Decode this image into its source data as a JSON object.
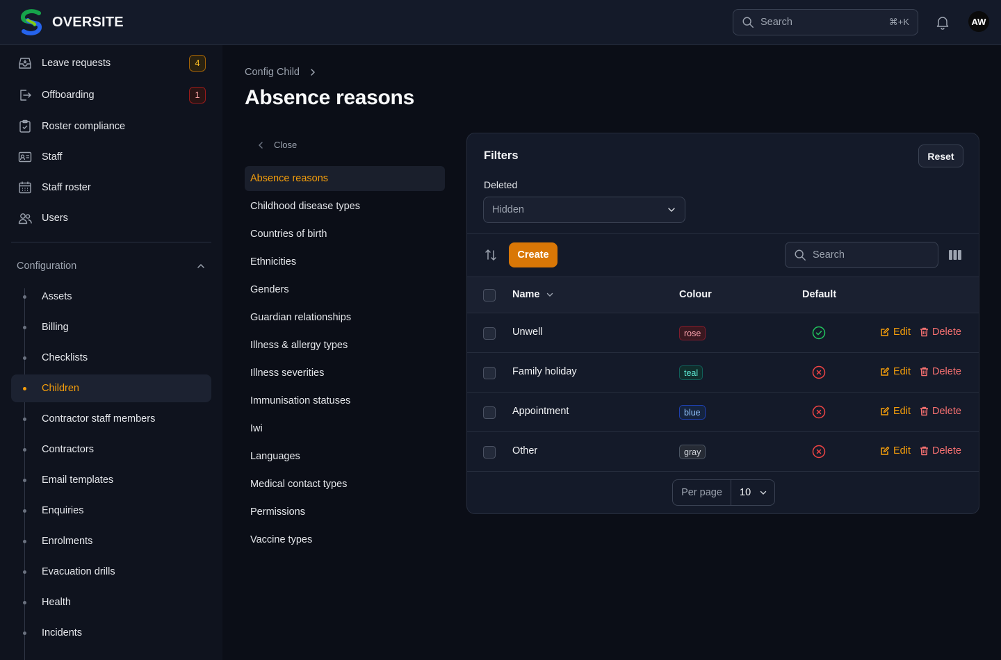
{
  "app": {
    "name": "OVERSITE"
  },
  "topbar": {
    "search_placeholder": "Search",
    "search_shortcut": "⌘+K",
    "avatar_initials": "AW"
  },
  "sidebar": {
    "items": [
      {
        "label": "Leave requests",
        "icon": "inbox-icon",
        "badge": "4",
        "badge_color": "yellow"
      },
      {
        "label": "Offboarding",
        "icon": "exit-icon",
        "badge": "1",
        "badge_color": "red"
      },
      {
        "label": "Roster compliance",
        "icon": "clipboard-check-icon"
      },
      {
        "label": "Staff",
        "icon": "id-card-icon"
      },
      {
        "label": "Staff roster",
        "icon": "calendar-icon"
      },
      {
        "label": "Users",
        "icon": "users-icon"
      }
    ],
    "group_label": "Configuration",
    "config_items": [
      "Assets",
      "Billing",
      "Checklists",
      "Children",
      "Contractor staff members",
      "Contractors",
      "Email templates",
      "Enquiries",
      "Enrolments",
      "Evacuation drills",
      "Health",
      "Incidents"
    ],
    "active_config": "Children"
  },
  "breadcrumb": {
    "parent": "Config Child"
  },
  "page": {
    "title": "Absence reasons"
  },
  "subnav": {
    "close_label": "Close",
    "items": [
      "Absence reasons",
      "Childhood disease types",
      "Countries of birth",
      "Ethnicities",
      "Genders",
      "Guardian relationships",
      "Illness & allergy types",
      "Illness severities",
      "Immunisation statuses",
      "Iwi",
      "Languages",
      "Medical contact types",
      "Permissions",
      "Vaccine types"
    ],
    "active": "Absence reasons"
  },
  "filters": {
    "title": "Filters",
    "reset_label": "Reset",
    "deleted_label": "Deleted",
    "deleted_value": "Hidden"
  },
  "toolbar": {
    "create_label": "Create",
    "search_placeholder": "Search"
  },
  "table": {
    "columns": [
      "Name",
      "Colour",
      "Default"
    ],
    "rows": [
      {
        "name": "Unwell",
        "colour": "rose",
        "default": true
      },
      {
        "name": "Family holiday",
        "colour": "teal",
        "default": false
      },
      {
        "name": "Appointment",
        "colour": "blue",
        "default": false
      },
      {
        "name": "Other",
        "colour": "gray",
        "default": false
      }
    ],
    "edit_label": "Edit",
    "delete_label": "Delete"
  },
  "pagination": {
    "per_page_label": "Per page",
    "per_page_value": "10"
  },
  "colors": {
    "accent": "#f59e0b",
    "create_button": "#d97706",
    "danger": "#f87171",
    "success": "#22c55e",
    "error": "#ef4444"
  }
}
